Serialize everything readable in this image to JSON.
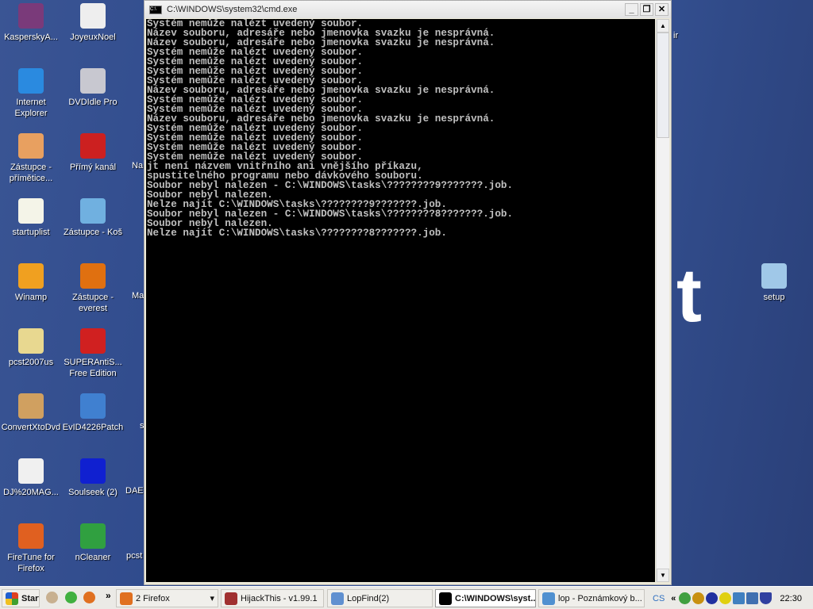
{
  "desktop": {
    "icons": [
      {
        "label": "KasperskyA...",
        "color": "#7a3a7a"
      },
      {
        "label": "JoyeuxNoel",
        "color": "#eeeeee"
      },
      {
        "label": "Internet Explorer",
        "color": "#2a8ae0"
      },
      {
        "label": "DVDIdle Pro",
        "color": "#c8c8d0"
      },
      {
        "label": "Zástupce - přímětice...",
        "color": "#e8a060"
      },
      {
        "label": "Přímý kanál",
        "color": "#cc2020"
      },
      {
        "label": "startuplist",
        "color": "#f4f4e8"
      },
      {
        "label": "Zástupce - Koš",
        "color": "#70b0e0"
      },
      {
        "label": "Winamp",
        "color": "#f0a020"
      },
      {
        "label": "Zástupce - everest",
        "color": "#e07010"
      },
      {
        "label": "pcst2007us",
        "color": "#e8d890"
      },
      {
        "label": "SUPERAntiS... Free Edition",
        "color": "#d02020"
      },
      {
        "label": "ConvertXtoDvd",
        "color": "#d0a060"
      },
      {
        "label": "EvID4226Patch",
        "color": "#4080d0"
      },
      {
        "label": "DJ%20MAG...",
        "color": "#f0f0f0"
      },
      {
        "label": "Soulseek (2)",
        "color": "#1020d0"
      },
      {
        "label": "FireTune for Firefox",
        "color": "#e06020"
      },
      {
        "label": "nCleaner",
        "color": "#30a040"
      },
      {
        "label": "setup",
        "color": "#a0c8e8"
      }
    ],
    "partial_labels": [
      "Na",
      "Ma",
      "s",
      "DAE",
      "pcst",
      "ir"
    ],
    "wallpaper_letter": "t"
  },
  "window": {
    "title": "C:\\WINDOWS\\system32\\cmd.exe",
    "buttons": {
      "minimize": "_",
      "restore": "❐",
      "close": "✕"
    },
    "console_lines": [
      "Systém nemůže nalézt uvedený soubor.",
      "Název souboru, adresáře nebo jmenovka svazku je nesprávná.",
      "Název souboru, adresáře nebo jmenovka svazku je nesprávná.",
      "Systém nemůže nalézt uvedený soubor.",
      "Systém nemůže nalézt uvedený soubor.",
      "Systém nemůže nalézt uvedený soubor.",
      "Systém nemůže nalézt uvedený soubor.",
      "Název souboru, adresáře nebo jmenovka svazku je nesprávná.",
      "Systém nemůže nalézt uvedený soubor.",
      "Systém nemůže nalézt uvedený soubor.",
      "Název souboru, adresáře nebo jmenovka svazku je nesprávná.",
      "Systém nemůže nalézt uvedený soubor.",
      "Systém nemůže nalézt uvedený soubor.",
      "Systém nemůže nalézt uvedený soubor.",
      "Systém nemůže nalézt uvedený soubor.",
      "jt není názvem vnitřního ani vnějšího příkazu,",
      "spustitelného programu nebo dávkového souboru.",
      "Soubor nebyl nalezen - C:\\WINDOWS\\tasks\\????????9???????.job.",
      "Soubor nebyl nalezen.",
      "Nelze najít C:\\WINDOWS\\tasks\\????????9???????.job.",
      "Soubor nebyl nalezen - C:\\WINDOWS\\tasks\\????????8???????.job.",
      "Soubor nebyl nalezen.",
      "Nelze najít C:\\WINDOWS\\tasks\\????????8???????.job."
    ]
  },
  "taskbar": {
    "start": "Start",
    "chevron": "»",
    "tasks": [
      {
        "label": "2 Firefox",
        "arrow": "▾",
        "color": "#e07020"
      },
      {
        "label": "HijackThis - v1.99.1",
        "color": "#a03030"
      },
      {
        "label": "LopFind(2)",
        "color": "#6090d0"
      },
      {
        "label": "C:\\WINDOWS\\syst...",
        "color": "#000000"
      },
      {
        "label": "lop - Poznámkový b...",
        "color": "#5090d0"
      }
    ],
    "tray": {
      "lang": "CS",
      "expand": "«",
      "clock": "22:30"
    }
  }
}
